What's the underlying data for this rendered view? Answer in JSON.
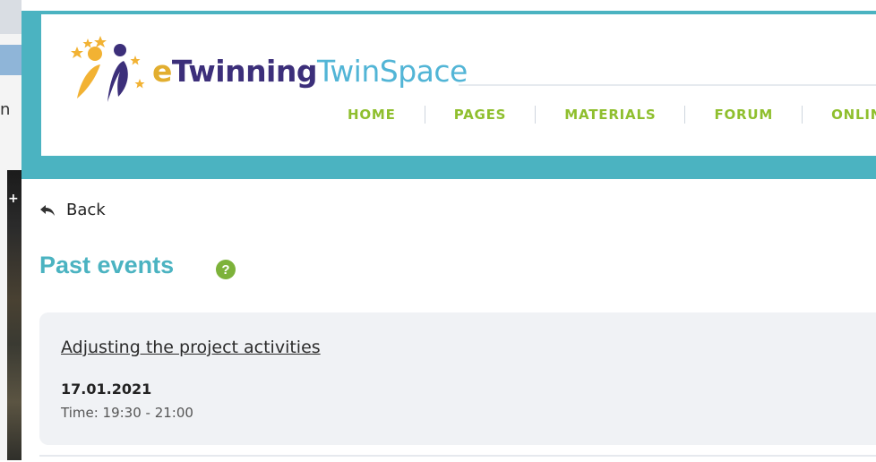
{
  "background_window": {
    "partial_text": "n"
  },
  "header": {
    "logo": {
      "e": "e",
      "twinning": "Twinning",
      "twinspace": "TwinSpace"
    },
    "nav": [
      {
        "label": "HOME"
      },
      {
        "label": "PAGES"
      },
      {
        "label": "MATERIALS"
      },
      {
        "label": "FORUM"
      },
      {
        "label": "ONLIN"
      }
    ]
  },
  "back": {
    "label": "Back",
    "icon": "back-arrow-icon"
  },
  "section": {
    "title": "Past events",
    "help_icon": "?"
  },
  "events": [
    {
      "title": "Adjusting the project activities",
      "date": "17.01.2021",
      "time": "Time: 19:30 - 21:00"
    }
  ],
  "colors": {
    "teal": "#4bb3c1",
    "nav_green": "#8fbf2e",
    "help_green": "#7db23a",
    "logo_purple": "#3c2f7a",
    "logo_yellow": "#e2ae2f",
    "logo_blue": "#52b5d6"
  }
}
